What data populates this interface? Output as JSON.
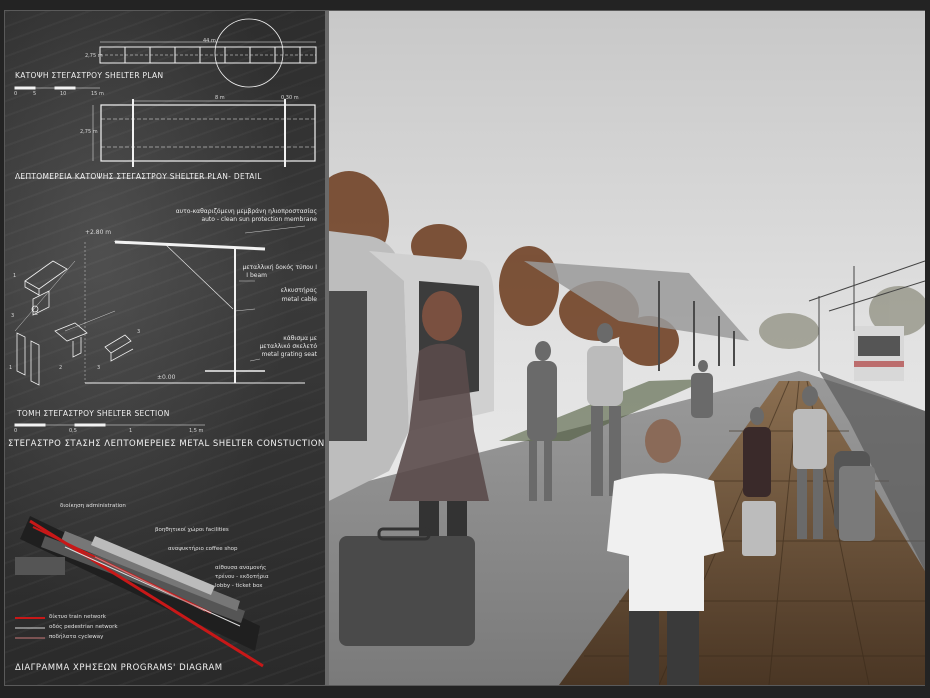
{
  "plan": {
    "title": "ΚΑΤΟΨΗ ΣΤΕΓΑΣΤΡΟΥ SHELTER PLAN",
    "dim_length": "44 m",
    "dim_width": "2,75 m",
    "scale": [
      "0",
      "5",
      "10",
      "15 m"
    ]
  },
  "detail": {
    "title": "ΛΕΠΤΟΜΕΡΕΙΑ ΚΑΤΟΨΗΣ ΣΤΕΓΑΣΤΡΟΥ SHELTER PLAN- DETAIL",
    "dim_span": "8 m",
    "dim_small": "0,30 m",
    "dim_width": "2,75 m"
  },
  "section": {
    "title": "ΤΟΜΗ ΣΤΕΓΑΣΤΡΟΥ   SHELTER SECTION",
    "level_top": "+2.80 m",
    "level_base": "±0.00",
    "scale": [
      "0",
      "0,5",
      "1",
      "1,5 m"
    ],
    "labels": [
      {
        "gr": "αυτο-καθαριζόμενη μεμβράνη ηλιοπροστασίας",
        "en": "auto - clean sun protection membrane"
      },
      {
        "gr": "μεταλλική δοκός τύπου I",
        "en": "I beam"
      },
      {
        "gr": "ελκυστήρας",
        "en": "metal cable"
      },
      {
        "gr": "κάθισμα με",
        "en2": "μεταλλικό σκελετό",
        "en": "metal grating seat"
      }
    ],
    "callouts": [
      "1",
      "2",
      "3",
      "3",
      "1",
      "2",
      "3"
    ]
  },
  "details_title": "ΣΤΕΓΑΣΤΡΟ ΣΤΑΣΗΣ ΛΕΠΤΟΜΕΡΕΙΕΣ METAL SHELTER CONSTUCTION DETAILS",
  "diagram": {
    "title": "ΔΙΑΓΡΑΜΜΑ ΧΡΗΣΕΩΝ  PROGRAMS' DIAGRAM",
    "labels": [
      "διοίκηση   administration",
      "βοηθητικοί χώροι  facilities",
      "αναψυκτήριο   coffee shop",
      "αίθουσα αναμονής",
      "τρένου - εκδοτήρια",
      "lobby - ticket box"
    ],
    "legend": [
      {
        "text": "δίκτυο   train network",
        "color": "#c81818"
      },
      {
        "text": "οδός   pedestrian network",
        "color": "#d9d9d9"
      },
      {
        "text": "ποδήλατα  cycleway",
        "color": "#c87878"
      }
    ]
  },
  "colors": {
    "accent_red": "#c81818",
    "panel": "#333333"
  }
}
